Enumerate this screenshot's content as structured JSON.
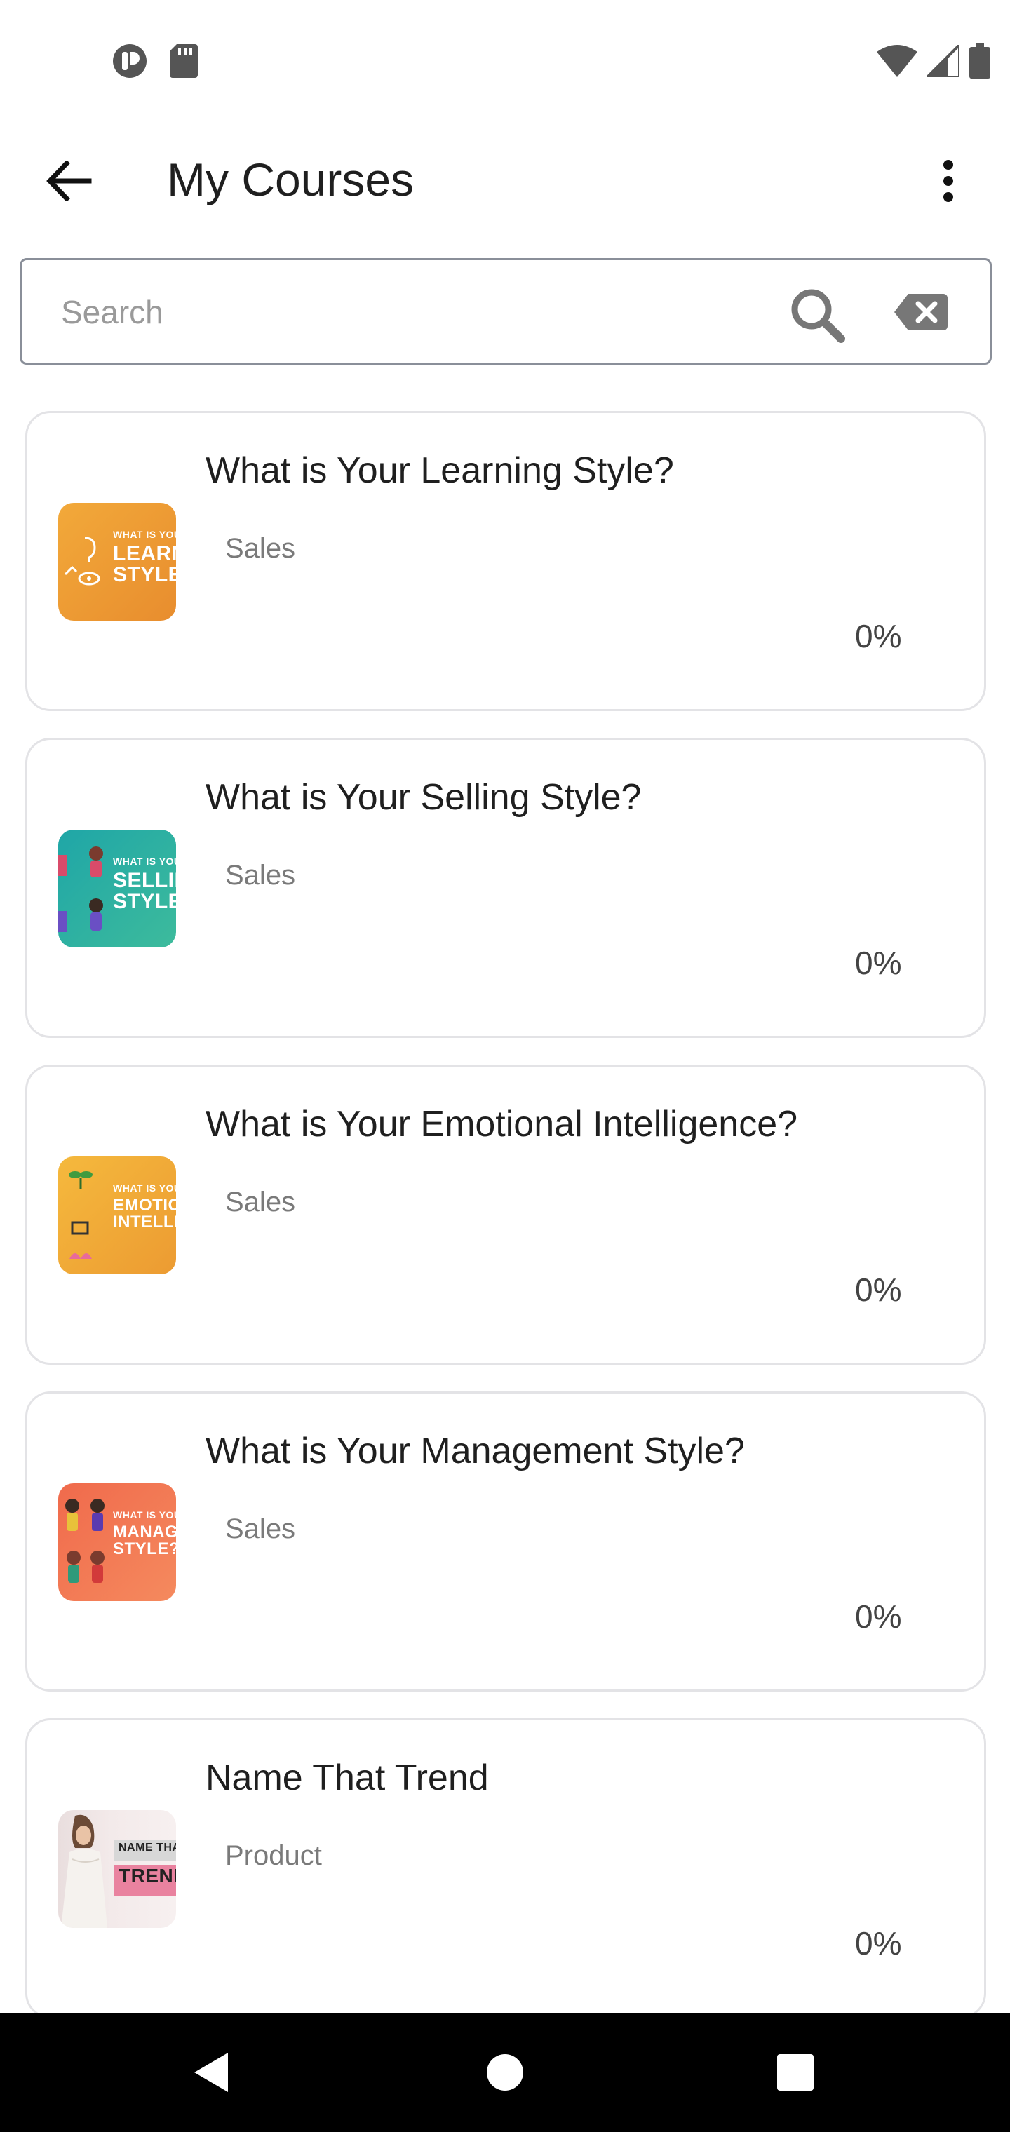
{
  "status_bar": {
    "icons_left": [
      "app-notification-icon",
      "sd-card-icon"
    ],
    "icons_right": [
      "wifi-icon",
      "cell-signal-icon",
      "battery-icon"
    ]
  },
  "app_bar": {
    "title": "My Courses",
    "back_icon": "arrow-left-icon",
    "more_icon": "more-vert-icon"
  },
  "search": {
    "placeholder": "Search",
    "value": ""
  },
  "courses": [
    {
      "title": "What is Your Learning Style?",
      "category": "Sales",
      "progress": "0%",
      "thumb_small": "WHAT IS YOU",
      "thumb_big": "LEARNIN STYLE?",
      "thumb_color_a": "#f2a93a",
      "thumb_color_b": "#e88d2e"
    },
    {
      "title": "What is Your Selling Style?",
      "category": "Sales",
      "progress": "0%",
      "thumb_small": "WHAT IS YOU",
      "thumb_big": "SELLIN STYLE?",
      "thumb_color_a": "#1fa6a7",
      "thumb_color_b": "#3dbb9c"
    },
    {
      "title": "What is Your Emotional Intelligence?",
      "category": "Sales",
      "progress": "0%",
      "thumb_small": "WHAT IS YOU",
      "thumb_big": "EMOTIONA INTELLIGENC",
      "thumb_color_a": "#f5b93d",
      "thumb_color_b": "#ec9b32"
    },
    {
      "title": "What is Your Management Style?",
      "category": "Sales",
      "progress": "0%",
      "thumb_small": "WHAT IS YOU",
      "thumb_big": "MANAGEME STYLE?",
      "thumb_color_a": "#f06a4c",
      "thumb_color_b": "#f58a5e"
    },
    {
      "title": "Name That Trend",
      "category": "Product",
      "progress": "0%",
      "thumb_small": "NAME THAT",
      "thumb_big": "TREND",
      "thumb_color_a": "#f2e6e6",
      "thumb_color_b": "#e88aa4"
    }
  ],
  "nav_bar": {
    "back_icon": "nav-back-icon",
    "home_icon": "nav-home-icon",
    "recents_icon": "nav-recents-icon"
  }
}
